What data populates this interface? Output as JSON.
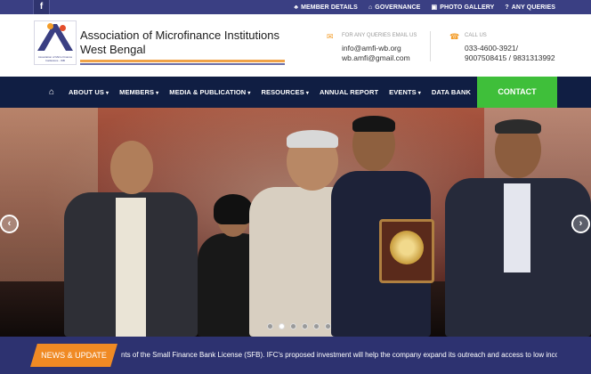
{
  "topbar": {
    "social_icon": "facebook-icon",
    "social_glyph": "f",
    "links": [
      {
        "label": "MEMBER DETAILS",
        "icon": "user-icon",
        "glyph": "♣"
      },
      {
        "label": "GOVERNANCE",
        "icon": "building-icon",
        "glyph": "⌂"
      },
      {
        "label": "PHOTO GALLERY",
        "icon": "image-icon",
        "glyph": "▣"
      },
      {
        "label": "ANY QUERIES",
        "icon": "question-icon",
        "glyph": "?"
      }
    ]
  },
  "header": {
    "logo_tag": "Association of Micro Finance Institutions - WB",
    "org_name_line1": "Association of Microfinance Institutions",
    "org_name_line2": "West Bengal",
    "email_label": "FOR ANY QUERIES EMAIL US",
    "email_1": "info@amfi-wb.org",
    "email_2": "wb.amfi@gmail.com",
    "call_label": "CALL US",
    "phone_1": "033-4600-3921/",
    "phone_2": "9007508415 / 9831313992"
  },
  "nav": {
    "items": [
      {
        "label": "ABOUT US",
        "caret": "▾"
      },
      {
        "label": "MEMBERS",
        "caret": "▾"
      },
      {
        "label": "MEDIA & PUBLICATION",
        "caret": "▾"
      },
      {
        "label": "RESOURCES",
        "caret": "▾"
      },
      {
        "label": "ANNUAL REPORT",
        "caret": ""
      },
      {
        "label": "EVENTS",
        "caret": "▾"
      },
      {
        "label": "DATA BANK",
        "caret": ""
      }
    ],
    "contact_label": "CONTACT"
  },
  "slider": {
    "prev_glyph": "‹",
    "next_glyph": "›",
    "slide_count": 6,
    "active_index": 1
  },
  "news": {
    "tag_label": "NEWS & UPDATE",
    "ticker_text": "nts of the Small Finance Bank License (SFB). IFC's proposed investment will help the company expand its outreach and access to low income"
  },
  "colors": {
    "brand_navy": "#3a3f83",
    "nav_bg": "#101e43",
    "accent_orange": "#f08a24",
    "contact_green": "#3fbf3a"
  }
}
